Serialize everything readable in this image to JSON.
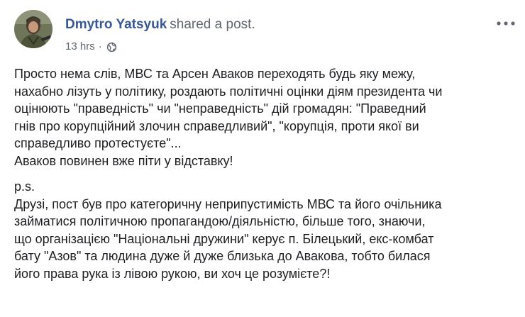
{
  "header": {
    "author": "Dmytro Yatsyuk",
    "action": "shared a post.",
    "time": "13 hrs",
    "separator": "·",
    "privacy_icon": "globe-icon",
    "menu_icon": "more-options-icon"
  },
  "post": {
    "paragraph1": [
      "Просто нема слів, МВС та Арсен Аваков переходять будь яку межу,",
      "нахабно лізуть у політику, роздають політичні оцінки діям президента чи",
      "оцінюють \"праведність\" чи \"неправедність\" дій громадян: \"Праведний",
      "гнів про корупційний злочин справедливий\", \"корупція, проти якої ви",
      "справедливо протестуєте\"...",
      "Аваков повинен вже піти у відставку!"
    ],
    "paragraph2": [
      "p.s.",
      "Друзі, пост був про категоричну неприпустимість МВС та його очільника",
      "займатися політичною пропагандою/діяльністю, більше того, знаючи,",
      "що організацією \"Національні дружини\" керує п. Білецький, екс-комбат",
      "бату \"Азов\" та людина дуже й дуже близька до Авакова, тобто билася",
      "його права рука із лівою рукою, ви хоч це розумієте?!"
    ]
  },
  "colors": {
    "author": "#385898",
    "meta": "#606770",
    "text": "#1c1e21"
  }
}
